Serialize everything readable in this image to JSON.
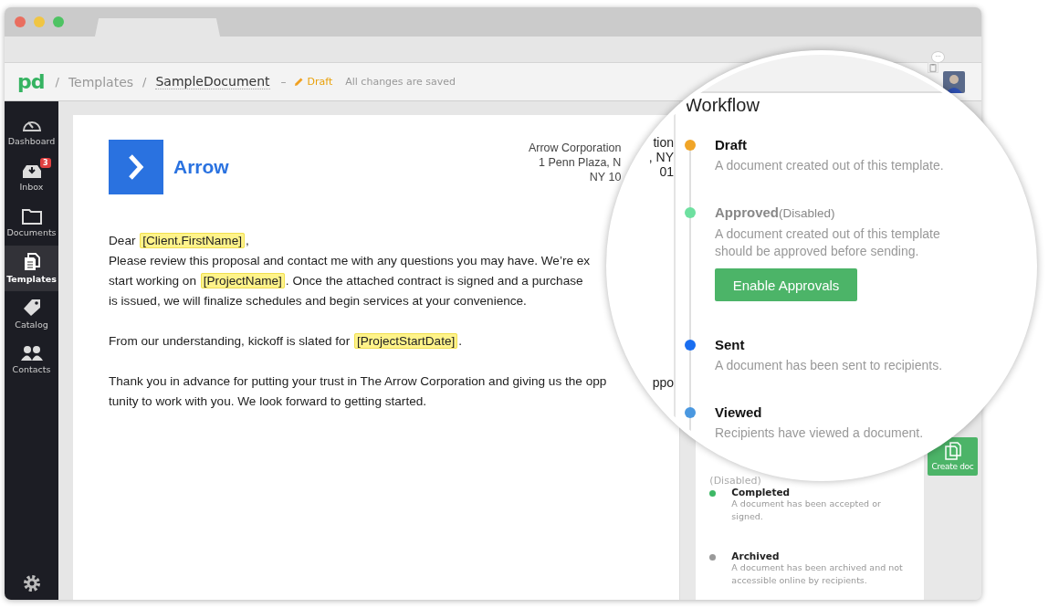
{
  "topbar": {
    "logo": "pd",
    "breadcrumbs": [
      {
        "text": "/",
        "kind": "sep"
      },
      {
        "text": "Templates",
        "kind": "link"
      },
      {
        "text": "/",
        "kind": "sep"
      },
      {
        "text": "SampleDocument",
        "kind": "current"
      }
    ],
    "dash": "–",
    "status": "Draft",
    "saved": "All changes are saved",
    "notification_badge": "···"
  },
  "sidebar": {
    "items": [
      {
        "label": "Dashboard",
        "selected": false
      },
      {
        "label": "Inbox",
        "selected": false,
        "badge": "3"
      },
      {
        "label": "Documents",
        "selected": false
      },
      {
        "label": "Templates",
        "selected": true
      },
      {
        "label": "Catalog",
        "selected": false
      },
      {
        "label": "Contacts",
        "selected": false
      }
    ]
  },
  "document": {
    "logo_text": "Arrow",
    "address": [
      "Arrow Corporation",
      "1 Penn Plaza, N",
      "NY 10"
    ],
    "paragraphs": [
      {
        "lines": [
          [
            {
              "kind": "text",
              "text": "Dear "
            },
            {
              "kind": "field",
              "text": "[Client.FirstName]"
            },
            {
              "kind": "text",
              "text": ","
            }
          ],
          [
            {
              "kind": "text",
              "text": "Please review this proposal and contact me with any questions you may have. We’re ex"
            }
          ],
          [
            {
              "kind": "text",
              "text": "start working on "
            },
            {
              "kind": "field",
              "text": "[ProjectName]"
            },
            {
              "kind": "text",
              "text": ". Once the attached contract is signed and a purchase"
            }
          ],
          [
            {
              "kind": "text",
              "text": "is issued, we will finalize schedules and begin services at your convenience."
            }
          ]
        ]
      },
      {
        "lines": [
          [
            {
              "kind": "text",
              "text": "From our understanding, kickoff is slated for "
            },
            {
              "kind": "field",
              "text": "[ProjectStartDate]"
            },
            {
              "kind": "text",
              "text": "."
            }
          ]
        ]
      },
      {
        "lines": [
          [
            {
              "kind": "text",
              "text": "Thank you in advance for putting your trust in The Arrow Corporation and giving us the opp"
            }
          ],
          [
            {
              "kind": "text",
              "text": "tunity to work with you.   We look forward to getting started."
            }
          ]
        ]
      }
    ]
  },
  "panel": {
    "fragment": "(Disabled)",
    "items": [
      {
        "title": "Completed",
        "description": "A document has been accepted or signed.",
        "color": "#3db865"
      },
      {
        "title": "Archived",
        "description": "A document has been archived and not accessible online by recipients.",
        "color": "#999999"
      }
    ],
    "create_button": "Create doc"
  },
  "magnifier": {
    "fragments": [
      "tion",
      ", NY",
      "01",
      "ppo"
    ],
    "title": "Workflow",
    "items": [
      {
        "title": "Draft",
        "description": "A document created out of this template.",
        "color": "#f0a528",
        "disabled": false
      },
      {
        "title": "Approved",
        "note": "(Disabled)",
        "description": "A document created out of this template should be approved before sending.",
        "color": "#6ee0a0",
        "disabled": true,
        "button": "Enable Approvals"
      },
      {
        "title": "Sent",
        "description": "A document has been sent to recipients.",
        "color": "#1a6ef0",
        "disabled": false
      },
      {
        "title": "Viewed",
        "description": "Recipients have viewed a document.",
        "color": "#4a98e0",
        "disabled": false
      }
    ]
  }
}
